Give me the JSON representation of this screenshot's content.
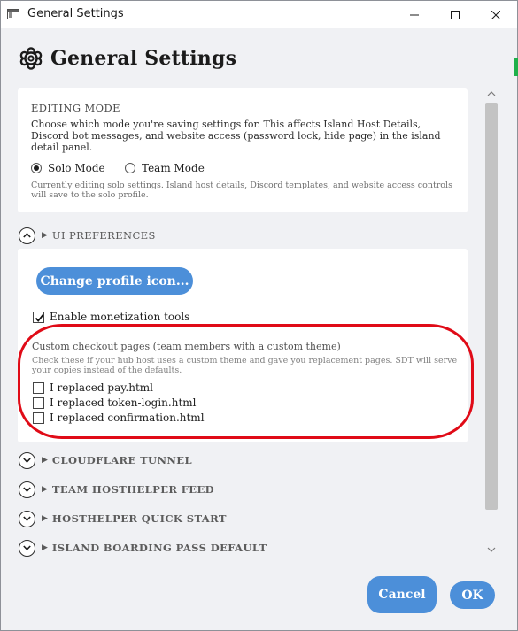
{
  "window": {
    "title": "General Settings"
  },
  "header": {
    "title": "General Settings",
    "icon": "gear-icon"
  },
  "editing_mode": {
    "label": "EDITING MODE",
    "description": "Choose which mode you're saving settings for. This affects Island Host Details, Discord bot messages, and website access (password lock, hide page) in the island detail panel.",
    "options": [
      {
        "label": "Solo Mode",
        "checked": true
      },
      {
        "label": "Team Mode",
        "checked": false
      }
    ],
    "note": "Currently editing solo settings. Island host details, Discord templates, and website access controls will save to the solo profile."
  },
  "ui_preferences": {
    "header": "UI PREFERENCES",
    "change_icon_button": "Change profile icon...",
    "monetization": {
      "label": "Enable monetization tools",
      "checked": true
    },
    "custom_checkout": {
      "title": "Custom checkout pages (team members with a custom theme)",
      "note": "Check these if your hub host uses a custom theme and gave you replacement pages. SDT will serve your copies instead of the defaults.",
      "items": [
        {
          "label": "I replaced pay.html",
          "checked": false
        },
        {
          "label": "I replaced token-login.html",
          "checked": false
        },
        {
          "label": "I replaced confirmation.html",
          "checked": false
        }
      ]
    }
  },
  "sections": [
    {
      "label": "CLOUDFLARE TUNNEL"
    },
    {
      "label": "TEAM HOSTHELPER FEED"
    },
    {
      "label": "HOSTHELPER QUICK START"
    },
    {
      "label": "ISLAND BOARDING PASS DEFAULT"
    }
  ],
  "footer": {
    "cancel": "Cancel",
    "ok": "OK"
  },
  "colors": {
    "accent": "#4c8fd9",
    "highlight": "#e00b17",
    "background": "#f0f1f4"
  }
}
